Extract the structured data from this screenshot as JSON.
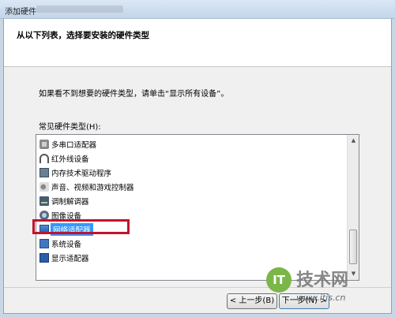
{
  "window": {
    "title": "添加硬件"
  },
  "header": {
    "title": "从以下列表，选择要安装的硬件类型"
  },
  "instruction": "如果看不到想要的硬件类型，请单击“显示所有设备”。",
  "list": {
    "label": "常见硬件类型(H):",
    "items": [
      {
        "label": "多串口适配器",
        "icon": "serial-port-icon"
      },
      {
        "label": "红外线设备",
        "icon": "infrared-icon"
      },
      {
        "label": "内存技术驱动程序",
        "icon": "memory-icon"
      },
      {
        "label": "声音、视频和游戏控制器",
        "icon": "sound-icon"
      },
      {
        "label": "调制解调器",
        "icon": "modem-icon"
      },
      {
        "label": "图像设备",
        "icon": "imaging-icon"
      },
      {
        "label": "网络适配器",
        "icon": "network-adapter-icon",
        "selected": true
      },
      {
        "label": "系统设备",
        "icon": "system-device-icon"
      },
      {
        "label": "显示适配器",
        "icon": "display-adapter-icon"
      }
    ]
  },
  "buttons": {
    "back": "< 上一步(B)",
    "next": "下一步(N) >"
  },
  "watermark": {
    "logo": "IT",
    "name": "技术网",
    "url": "www.itjs.cn"
  },
  "colors": {
    "selection": "#3399ff",
    "highlight_box": "#c0142c"
  }
}
